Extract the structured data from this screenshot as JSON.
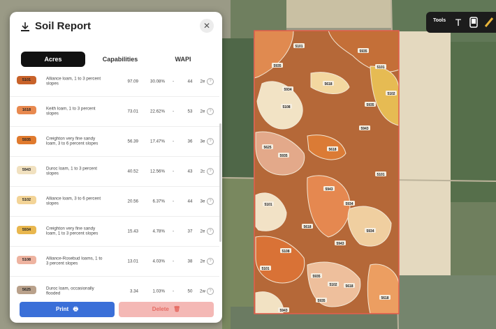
{
  "panel": {
    "title": "Soil Report",
    "close_glyph": "✕"
  },
  "tabs": [
    {
      "label": "Acres",
      "active": true
    },
    {
      "label": "Capabilities",
      "active": false
    },
    {
      "label": "WAPI",
      "active": false
    }
  ],
  "soils": [
    {
      "code": "5101",
      "name": "Alliance loam, 1 to 3 percent slopes",
      "acres": "97.09",
      "pct": "30.08%",
      "dash": "-",
      "rank": "44",
      "class": "2e",
      "color": "#c8622a"
    },
    {
      "code": "1618",
      "name": "Keith loam, 1 to 3 percent slopes",
      "acres": "73.01",
      "pct": "22.62%",
      "dash": "-",
      "rank": "53",
      "class": "2e",
      "color": "#e8894f"
    },
    {
      "code": "5935",
      "name": "Creighton very fine sandy loam, 3 to 6 percent slopes",
      "acres": "56.39",
      "pct": "17.47%",
      "dash": "-",
      "rank": "36",
      "class": "3e",
      "color": "#e07a2e"
    },
    {
      "code": "5943",
      "name": "Duroc loam, 1 to 3 percent slopes",
      "acres": "40.52",
      "pct": "12.56%",
      "dash": "-",
      "rank": "43",
      "class": "2c",
      "color": "#f1e1c0"
    },
    {
      "code": "5102",
      "name": "Alliance loam, 3 to 6 percent slopes",
      "acres": "20.56",
      "pct": "6.37%",
      "dash": "-",
      "rank": "44",
      "class": "3e",
      "color": "#f3d497"
    },
    {
      "code": "5934",
      "name": "Creighton very fine sandy loam, 1 to 3 percent slopes",
      "acres": "15.43",
      "pct": "4.78%",
      "dash": "-",
      "rank": "37",
      "class": "2e",
      "color": "#e9b74e"
    },
    {
      "code": "5108",
      "name": "Alliance-Rosebud loams, 1 to 3 percent slopes",
      "acres": "13.01",
      "pct": "4.03%",
      "dash": "-",
      "rank": "38",
      "class": "2e",
      "color": "#eeb3a0"
    },
    {
      "code": "5625",
      "name": "Duroc loam, occasionally flooded",
      "acres": "3.34",
      "pct": "1.03%",
      "dash": "-",
      "rank": "50",
      "class": "2w",
      "color": "#b9a18b"
    }
  ],
  "info_glyph": "?",
  "actions": {
    "print_label": "Print",
    "print_icon": "🖶",
    "delete_label": "Delete",
    "delete_icon": "🗑"
  },
  "toolbar": {
    "label": "Tools",
    "text_tool_glyph": "T",
    "icons": [
      "text-tool-icon",
      "phone-tool-icon",
      "pencil-tool-icon"
    ]
  },
  "map_labels": [
    "5101",
    "5935",
    "5101",
    "5935",
    "5618",
    "5102",
    "5934",
    "5108",
    "5943",
    "5625",
    "5618",
    "5935",
    "5943",
    "5101",
    "5618",
    "5934",
    "5943",
    "5108",
    "5101",
    "5935",
    "5102",
    "5618",
    "5935",
    "5943",
    "5934",
    "5101",
    "5618",
    "5935"
  ]
}
